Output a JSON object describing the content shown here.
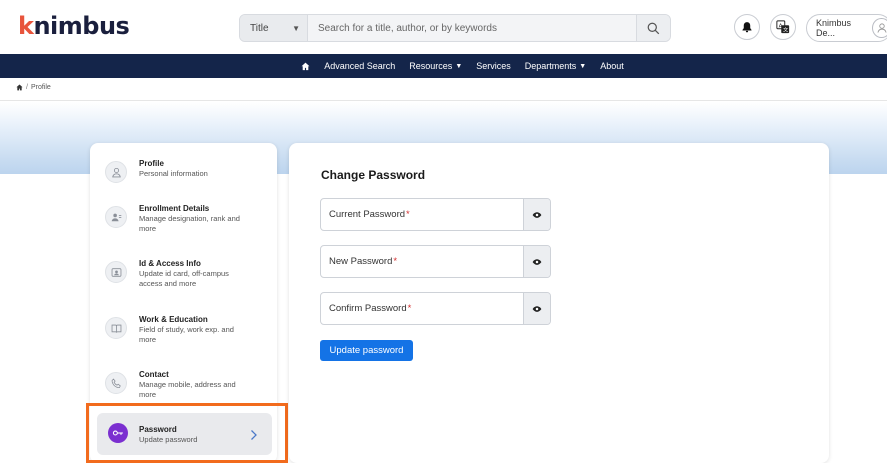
{
  "brand": {
    "logo_k": "k",
    "logo_rest": "nimbus",
    "accent": "#e8543c"
  },
  "header": {
    "search_type": "Title",
    "search_placeholder": "Search for a title, author, or by keywords",
    "user_name": "Knimbus De..."
  },
  "nav": {
    "items": [
      {
        "label": "Advanced Search",
        "dropdown": false
      },
      {
        "label": "Resources",
        "dropdown": true
      },
      {
        "label": "Services",
        "dropdown": false
      },
      {
        "label": "Departments",
        "dropdown": true
      },
      {
        "label": "About",
        "dropdown": false
      }
    ],
    "bg": "#14254a"
  },
  "breadcrumb": {
    "sep": "/",
    "current": "Profile"
  },
  "sidebar": {
    "items": [
      {
        "title": "Profile",
        "desc": [
          "Personal information"
        ],
        "icon": "user-icon"
      },
      {
        "title": "Enrollment Details",
        "desc": [
          "Manage designation, rank and",
          "more"
        ],
        "icon": "users-icon"
      },
      {
        "title": "Id & Access Info",
        "desc": [
          "Update id card, off-campus",
          "access and more"
        ],
        "icon": "id-card-icon"
      },
      {
        "title": "Work & Education",
        "desc": [
          "Field of study, work exp. and",
          "more"
        ],
        "icon": "book-icon"
      },
      {
        "title": "Contact",
        "desc": [
          "Manage mobile, address and",
          "more"
        ],
        "icon": "phone-icon"
      }
    ],
    "active": {
      "title": "Password",
      "desc": "Update password",
      "icon": "key-icon",
      "color": "#7b2fd0"
    }
  },
  "main": {
    "title": "Change Password",
    "fields": [
      {
        "label": "Current Password",
        "required": "*"
      },
      {
        "label": "New Password",
        "required": "*"
      },
      {
        "label": "Confirm Password",
        "required": "*"
      }
    ],
    "submit_label": "Update password",
    "submit_color": "#1473e6"
  }
}
